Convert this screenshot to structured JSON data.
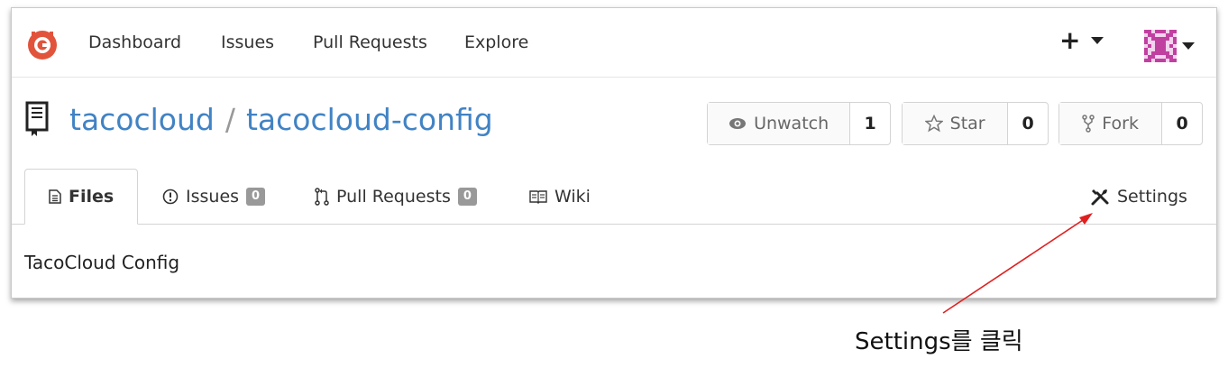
{
  "nav": {
    "items": [
      "Dashboard",
      "Issues",
      "Pull Requests",
      "Explore"
    ],
    "plus_label": "+"
  },
  "repo": {
    "owner": "tacocloud",
    "separator": "/",
    "name": "tacocloud-config",
    "description": "TacoCloud Config"
  },
  "actions": {
    "watch": {
      "label": "Unwatch",
      "count": "1"
    },
    "star": {
      "label": "Star",
      "count": "0"
    },
    "fork": {
      "label": "Fork",
      "count": "0"
    }
  },
  "tabs": {
    "files": "Files",
    "issues": {
      "label": "Issues",
      "count": "0"
    },
    "pulls": {
      "label": "Pull Requests",
      "count": "0"
    },
    "wiki": "Wiki",
    "settings": "Settings"
  },
  "annotation": {
    "text": "Settings를 클릭",
    "color": "#e02020"
  },
  "colors": {
    "link": "#4183c4",
    "logo": "#e2533c",
    "avatar": "#c040a0"
  }
}
